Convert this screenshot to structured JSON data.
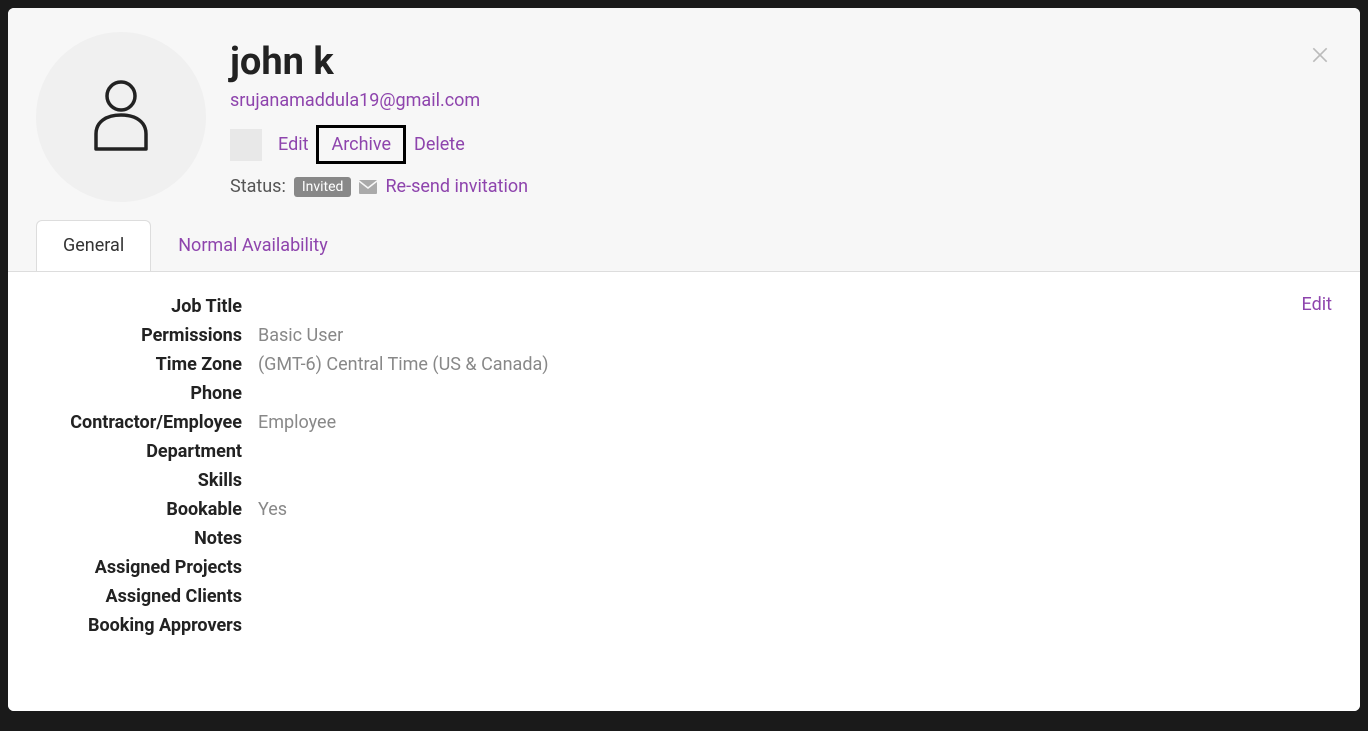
{
  "user": {
    "name": "john k",
    "email": "srujanamaddula19@gmail.com"
  },
  "actions": {
    "edit": "Edit",
    "archive": "Archive",
    "delete": "Delete"
  },
  "status": {
    "label": "Status:",
    "badge": "Invited",
    "resend": "Re-send invitation"
  },
  "tabs": {
    "general": "General",
    "availability": "Normal Availability"
  },
  "body": {
    "edit_link": "Edit"
  },
  "fields": {
    "job_title": {
      "label": "Job Title",
      "value": ""
    },
    "permissions": {
      "label": "Permissions",
      "value": "Basic User"
    },
    "time_zone": {
      "label": "Time Zone",
      "value": "(GMT-6) Central Time (US & Canada)"
    },
    "phone": {
      "label": "Phone",
      "value": ""
    },
    "contractor_employee": {
      "label": "Contractor/Employee",
      "value": "Employee"
    },
    "department": {
      "label": "Department",
      "value": ""
    },
    "skills": {
      "label": "Skills",
      "value": ""
    },
    "bookable": {
      "label": "Bookable",
      "value": "Yes"
    },
    "notes": {
      "label": "Notes",
      "value": ""
    },
    "assigned_projects": {
      "label": "Assigned Projects",
      "value": ""
    },
    "assigned_clients": {
      "label": "Assigned Clients",
      "value": ""
    },
    "booking_approvers": {
      "label": "Booking Approvers",
      "value": ""
    }
  }
}
